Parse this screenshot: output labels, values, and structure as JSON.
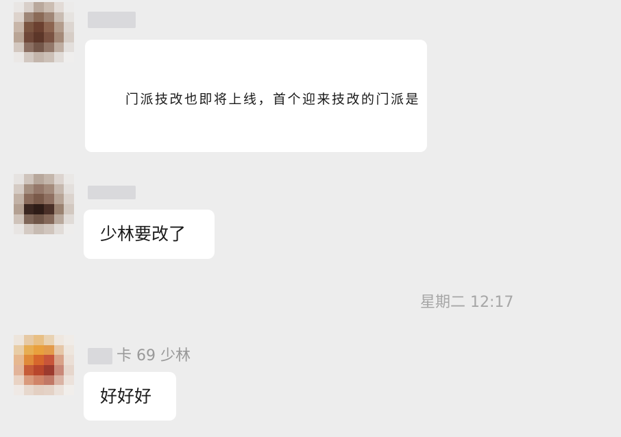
{
  "messages": [
    {
      "sender": "",
      "text": "门派技改也即将上线，首个迎来技改的门派是"
    },
    {
      "sender": "",
      "text": "少林要改了"
    },
    {
      "sender": "卡 69 少林",
      "text": "好好好"
    }
  ],
  "timestamp": "星期二 12:17",
  "colors": {
    "background": "#EDEDED",
    "bubble": "#FFFFFF",
    "meta_text": "#999999"
  }
}
